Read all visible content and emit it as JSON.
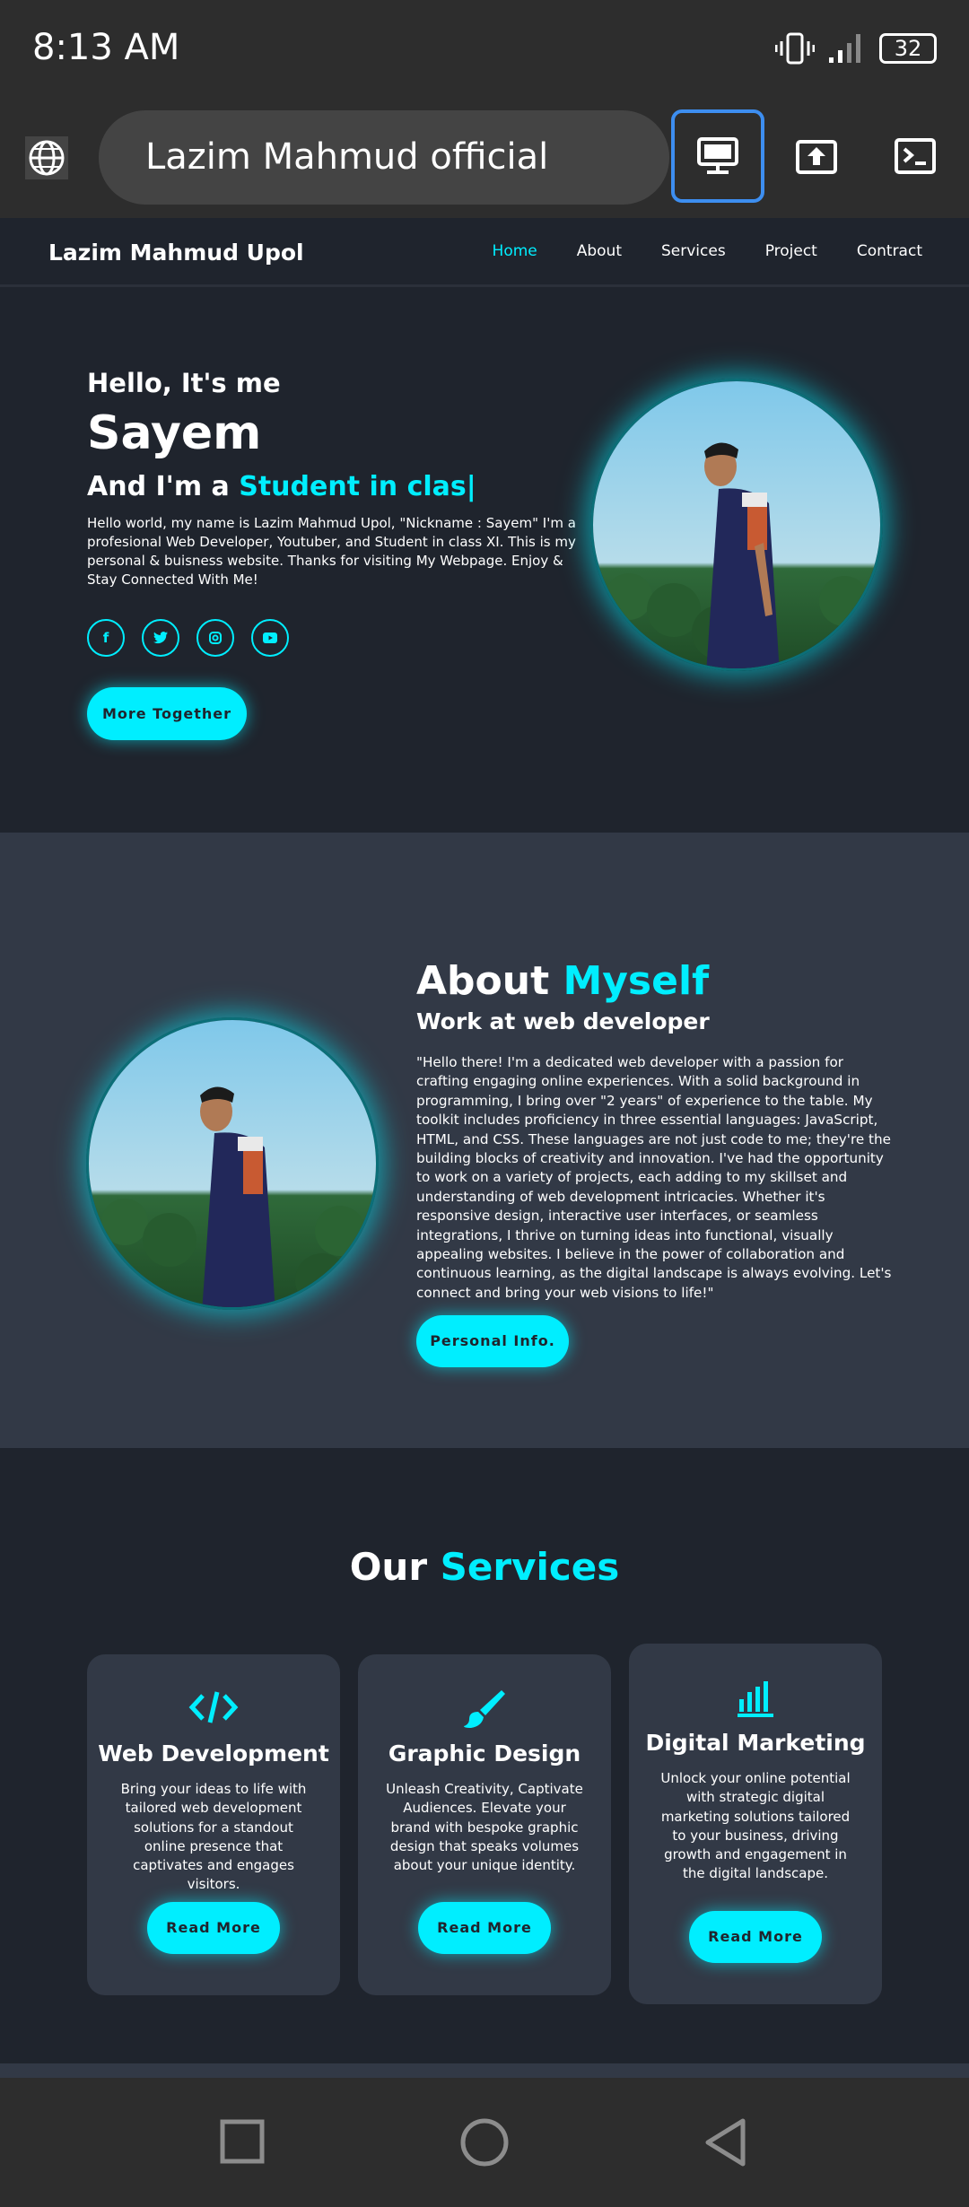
{
  "status_bar": {
    "time": "8:13 AM",
    "battery": "32"
  },
  "browser": {
    "url_title": "Lazim Mahmud official"
  },
  "site": {
    "logo": "Lazim Mahmud Upol",
    "nav": [
      {
        "label": "Home",
        "active": true
      },
      {
        "label": "About"
      },
      {
        "label": "Services"
      },
      {
        "label": "Project"
      },
      {
        "label": "Contract"
      }
    ]
  },
  "hero": {
    "greeting": "Hello, It's me",
    "name": "Sayem",
    "role_prefix": "And I'm a ",
    "role_typed": "Student in clas",
    "description": "Hello world, my name is Lazim Mahmud Upol, \"Nickname : Sayem\" I'm a profesional Web Developer, Youtuber, and Student in class XI. This is my personal & buisness website. Thanks for visiting My Webpage. Enjoy & Stay Connected With Me!",
    "socials": [
      "facebook-icon",
      "twitter-icon",
      "instagram-icon",
      "youtube-icon"
    ],
    "button": "More Together"
  },
  "about": {
    "title_main": "About ",
    "title_accent": "Myself",
    "subtitle": "Work at web developer",
    "description": "\"Hello there! I'm a dedicated web developer with a passion for crafting engaging online experiences. With a solid background in programming, I bring over \"2 years\" of experience to the table. My toolkit includes proficiency in three essential languages: JavaScript, HTML, and CSS. These languages are not just code to me; they're the building blocks of creativity and innovation. I've had the opportunity to work on a variety of projects, each adding to my skillset and understanding of web development intricacies. Whether it's responsive design, interactive user interfaces, or seamless integrations, I thrive on turning ideas into functional, visually appealing websites. I believe in the power of collaboration and continuous learning, as the digital landscape is always evolving. Let's connect and bring your web visions to life!\"",
    "button": "Personal Info."
  },
  "services": {
    "title_main": "Our ",
    "title_accent": "Services",
    "cards": [
      {
        "icon": "code-icon",
        "title": "Web Development",
        "description": "Bring your ideas to life with tailored web development solutions for a standout online presence that captivates and engages visitors.",
        "button": "Read More"
      },
      {
        "icon": "paintbrush-icon",
        "title": "Graphic Design",
        "description": "Unleash Creativity, Captivate Audiences. Elevate your brand with bespoke graphic design that speaks volumes about your unique identity.",
        "button": "Read More"
      },
      {
        "icon": "bar-chart-icon",
        "title": "Digital Marketing",
        "description": "Unlock your online potential with strategic digital marketing solutions tailored to your business, driving growth and engagement in the digital landscape.",
        "button": "Read More"
      }
    ]
  },
  "colors": {
    "accent": "#00eeff",
    "bg": "#1f242d",
    "bg_alt": "#323946"
  }
}
